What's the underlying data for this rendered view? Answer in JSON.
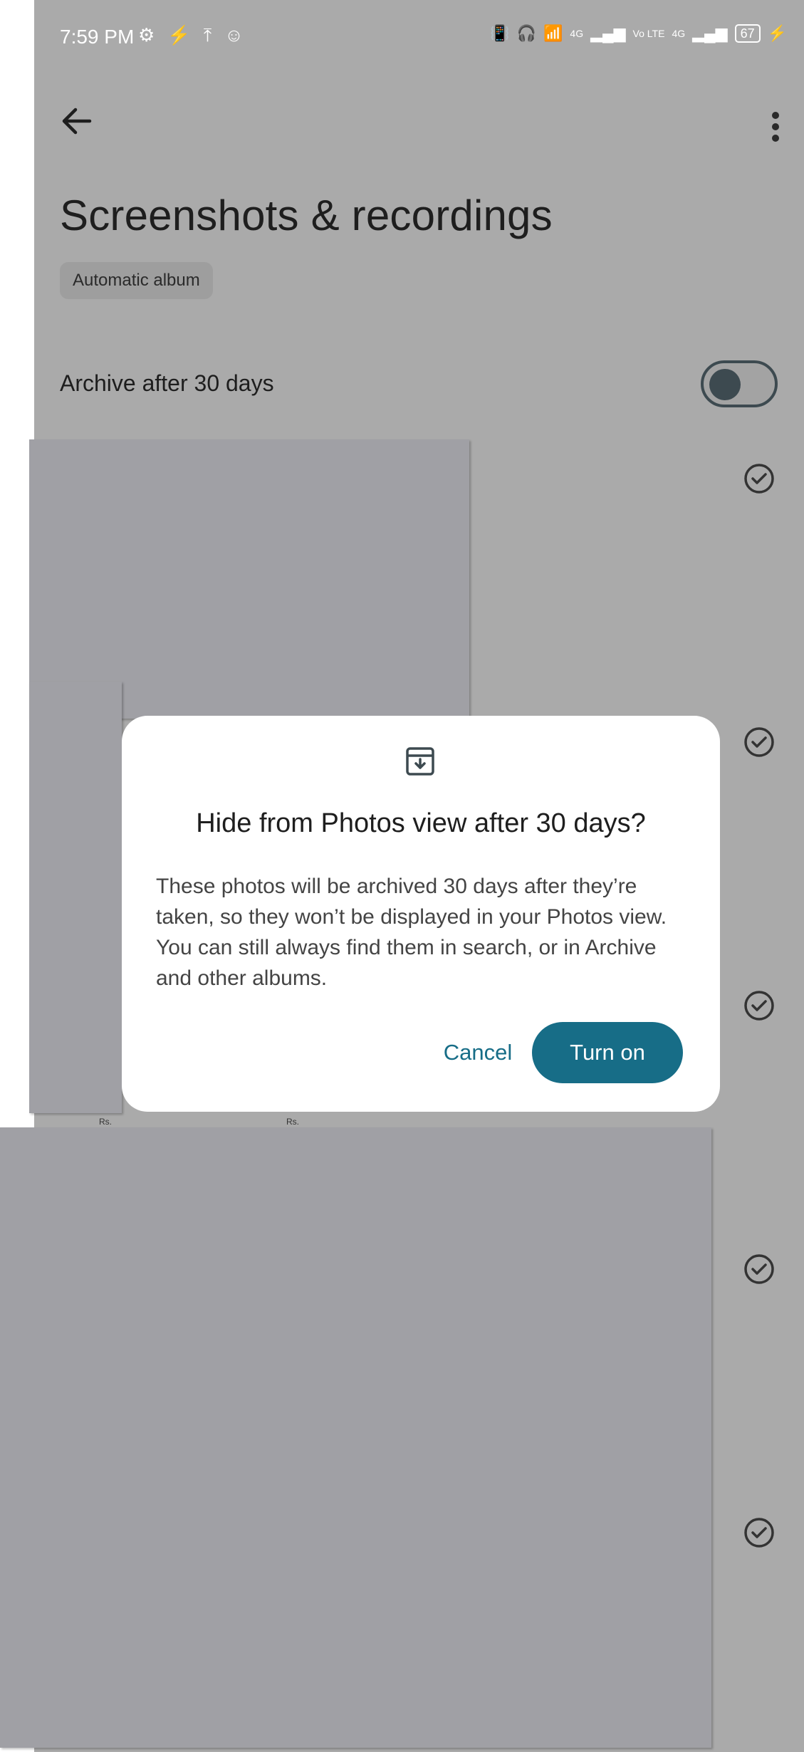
{
  "status_bar": {
    "time": "7:59 PM",
    "net1": "4G",
    "net2": "Vo LTE",
    "net3": "4G",
    "battery": "67"
  },
  "header": {
    "title": "Screenshots & recordings",
    "chip": "Automatic album"
  },
  "archive_setting": {
    "label": "Archive after 30 days",
    "enabled": false
  },
  "thumb_text": {
    "rs1": "Rs.",
    "rs2": "Rs."
  },
  "dialog": {
    "icon": "archive-download-icon",
    "title": "Hide from Photos view after 30 days?",
    "body": "These photos will be archived 30 days after they’re taken, so they won’t be displayed in your Photos view. You can still always find them in search, or in Archive and other albums.",
    "cancel_label": "Cancel",
    "confirm_label": "Turn on"
  },
  "colors": {
    "accent": "#176d87",
    "scrim": "#aaaaaa",
    "dialog_bg": "#ffffff"
  }
}
